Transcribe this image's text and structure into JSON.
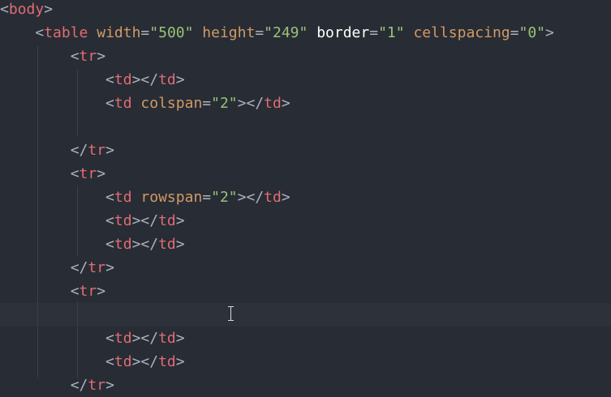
{
  "editor": {
    "colors": {
      "background": "#282c34",
      "tag": "#e06c75",
      "attribute": "#d19a66",
      "string": "#98c379",
      "punctuation": "#abb2bf"
    },
    "lines": [
      [
        {
          "t": "<",
          "c": "punct"
        },
        {
          "t": "body",
          "c": "tag"
        },
        {
          "t": ">",
          "c": "punct"
        }
      ],
      [
        {
          "t": "    ",
          "c": "punct"
        },
        {
          "t": "<",
          "c": "punct"
        },
        {
          "t": "table",
          "c": "tag"
        },
        {
          "t": " ",
          "c": "punct"
        },
        {
          "t": "width",
          "c": "attr"
        },
        {
          "t": "=",
          "c": "eq"
        },
        {
          "t": "\"500\"",
          "c": "str"
        },
        {
          "t": " ",
          "c": "punct"
        },
        {
          "t": "height",
          "c": "attr"
        },
        {
          "t": "=",
          "c": "eq"
        },
        {
          "t": "\"249\"",
          "c": "str"
        },
        {
          "t": " ",
          "c": "punct"
        },
        {
          "t": "border",
          "c": "attr-hl"
        },
        {
          "t": "=",
          "c": "eq"
        },
        {
          "t": "\"1\"",
          "c": "str"
        },
        {
          "t": " ",
          "c": "punct"
        },
        {
          "t": "cellspacing",
          "c": "attr"
        },
        {
          "t": "=",
          "c": "eq"
        },
        {
          "t": "\"0\"",
          "c": "str"
        },
        {
          "t": ">",
          "c": "punct"
        }
      ],
      [
        {
          "t": "        ",
          "c": "punct"
        },
        {
          "t": "<",
          "c": "punct"
        },
        {
          "t": "tr",
          "c": "tag"
        },
        {
          "t": ">",
          "c": "punct"
        }
      ],
      [
        {
          "t": "            ",
          "c": "punct"
        },
        {
          "t": "<",
          "c": "punct"
        },
        {
          "t": "td",
          "c": "tag"
        },
        {
          "t": "></",
          "c": "punct"
        },
        {
          "t": "td",
          "c": "tag"
        },
        {
          "t": ">",
          "c": "punct"
        }
      ],
      [
        {
          "t": "            ",
          "c": "punct"
        },
        {
          "t": "<",
          "c": "punct"
        },
        {
          "t": "td",
          "c": "tag"
        },
        {
          "t": " ",
          "c": "punct"
        },
        {
          "t": "colspan",
          "c": "attr"
        },
        {
          "t": "=",
          "c": "eq"
        },
        {
          "t": "\"2\"",
          "c": "str"
        },
        {
          "t": "></",
          "c": "punct"
        },
        {
          "t": "td",
          "c": "tag"
        },
        {
          "t": ">",
          "c": "punct"
        }
      ],
      [],
      [
        {
          "t": "        ",
          "c": "punct"
        },
        {
          "t": "</",
          "c": "punct"
        },
        {
          "t": "tr",
          "c": "tag"
        },
        {
          "t": ">",
          "c": "punct"
        }
      ],
      [
        {
          "t": "        ",
          "c": "punct"
        },
        {
          "t": "<",
          "c": "punct"
        },
        {
          "t": "tr",
          "c": "tag"
        },
        {
          "t": ">",
          "c": "punct"
        }
      ],
      [
        {
          "t": "            ",
          "c": "punct"
        },
        {
          "t": "<",
          "c": "punct"
        },
        {
          "t": "td",
          "c": "tag"
        },
        {
          "t": " ",
          "c": "punct"
        },
        {
          "t": "rowspan",
          "c": "attr"
        },
        {
          "t": "=",
          "c": "eq"
        },
        {
          "t": "\"2\"",
          "c": "str"
        },
        {
          "t": "></",
          "c": "punct"
        },
        {
          "t": "td",
          "c": "tag"
        },
        {
          "t": ">",
          "c": "punct"
        }
      ],
      [
        {
          "t": "            ",
          "c": "punct"
        },
        {
          "t": "<",
          "c": "punct"
        },
        {
          "t": "td",
          "c": "tag"
        },
        {
          "t": "></",
          "c": "punct"
        },
        {
          "t": "td",
          "c": "tag"
        },
        {
          "t": ">",
          "c": "punct"
        }
      ],
      [
        {
          "t": "            ",
          "c": "punct"
        },
        {
          "t": "<",
          "c": "punct"
        },
        {
          "t": "td",
          "c": "tag"
        },
        {
          "t": "></",
          "c": "punct"
        },
        {
          "t": "td",
          "c": "tag"
        },
        {
          "t": ">",
          "c": "punct"
        }
      ],
      [
        {
          "t": "        ",
          "c": "punct"
        },
        {
          "t": "</",
          "c": "punct"
        },
        {
          "t": "tr",
          "c": "tag"
        },
        {
          "t": ">",
          "c": "punct"
        }
      ],
      [
        {
          "t": "        ",
          "c": "punct"
        },
        {
          "t": "<",
          "c": "punct"
        },
        {
          "t": "tr",
          "c": "tag"
        },
        {
          "t": ">",
          "c": "punct"
        }
      ],
      [],
      [
        {
          "t": "            ",
          "c": "punct"
        },
        {
          "t": "<",
          "c": "punct"
        },
        {
          "t": "td",
          "c": "tag"
        },
        {
          "t": "></",
          "c": "punct"
        },
        {
          "t": "td",
          "c": "tag"
        },
        {
          "t": ">",
          "c": "punct"
        }
      ],
      [
        {
          "t": "            ",
          "c": "punct"
        },
        {
          "t": "<",
          "c": "punct"
        },
        {
          "t": "td",
          "c": "tag"
        },
        {
          "t": "></",
          "c": "punct"
        },
        {
          "t": "td",
          "c": "tag"
        },
        {
          "t": ">",
          "c": "punct"
        }
      ],
      [
        {
          "t": "        ",
          "c": "punct"
        },
        {
          "t": "</",
          "c": "punct"
        },
        {
          "t": "tr",
          "c": "tag"
        },
        {
          "t": ">",
          "c": "punct"
        }
      ]
    ],
    "active_line": 13,
    "cursor_icon": "text-cursor-icon"
  }
}
